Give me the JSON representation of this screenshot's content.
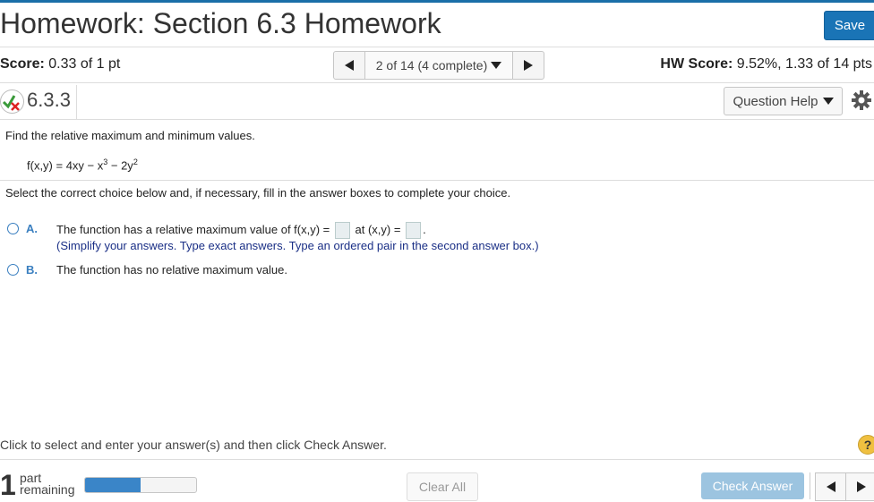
{
  "header": {
    "title": "Homework: Section 6.3 Homework",
    "save_label": "Save"
  },
  "score": {
    "label": "Score:",
    "value": "0.33 of 1 pt"
  },
  "navigator": {
    "text": "2 of 14 (4 complete)"
  },
  "hw_score": {
    "label": "HW Score:",
    "value": "9.52%, 1.33 of 14 pts"
  },
  "question": {
    "id": "6.3.3",
    "help_label": "Question Help",
    "prompt": "Find the relative maximum and minimum values.",
    "function_main": "f(x,y) = 4xy − x",
    "function_exp1": "3",
    "function_mid": " − 2y",
    "function_exp2": "2",
    "instruction": "Select the correct choice below and, if necessary, fill in the answer boxes to complete your choice."
  },
  "options": [
    {
      "label": "A.",
      "text_before": "The function has a relative maximum value of f(x,y) =",
      "text_middle": "at (x,y) =",
      "text_after": ".",
      "note": "(Simplify your answers. Type exact answers. Type an ordered pair in the second answer box.)"
    },
    {
      "label": "B.",
      "text": "The function has no relative maximum value."
    }
  ],
  "footer": {
    "hint": "Click to select and enter your answer(s) and then click Check Answer.",
    "parts_number": "1",
    "parts_label_line1": "part",
    "parts_label_line2": "remaining",
    "progress_fraction": 0.5,
    "clear_label": "Clear All",
    "check_label": "Check Answer"
  },
  "colors": {
    "accent": "#1a74b6",
    "progress": "#3a85c8",
    "option_label": "#3a7fc0"
  }
}
